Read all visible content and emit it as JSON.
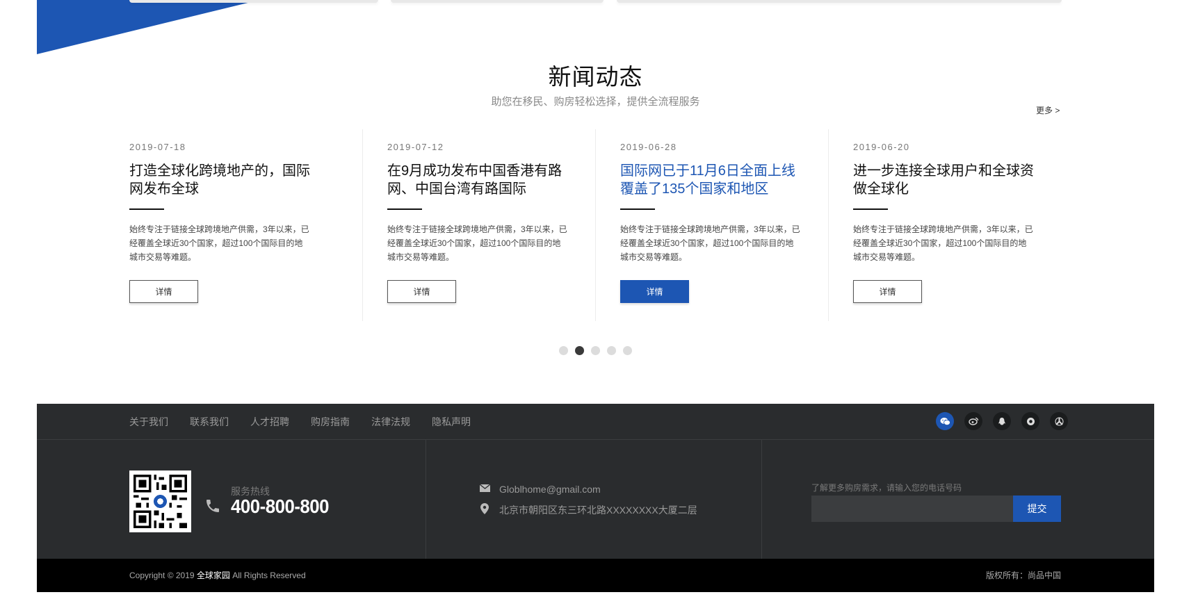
{
  "news": {
    "title": "新闻动态",
    "subtitle": "助您在移民、购房轻松选择，提供全流程服务",
    "more": "更多 >",
    "detail_label": "详情",
    "items": [
      {
        "date": "2019-07-18",
        "title": "打造全球化跨境地产的，国际网发布全球",
        "desc": "始终专注于链接全球跨境地产供需，3年以来，已经覆盖全球近30个国家，超过100个国际目的地城市交易等难题。"
      },
      {
        "date": "2019-07-12",
        "title": "在9月成功发布中国香港有路网、中国台湾有路国际",
        "desc": "始终专注于链接全球跨境地产供需，3年以来，已经覆盖全球近30个国家，超过100个国际目的地城市交易等难题。"
      },
      {
        "date": "2019-06-28",
        "title": "国际网已于11月6日全面上线覆盖了135个国家和地区",
        "desc": "始终专注于链接全球跨境地产供需，3年以来，已经覆盖全球近30个国家，超过100个国际目的地城市交易等难题。"
      },
      {
        "date": "2019-06-20",
        "title": "进一步连接全球用户和全球资做全球化",
        "desc": "始终专注于链接全球跨境地产供需，3年以来，已经覆盖全球近30个国家，超过100个国际目的地城市交易等难题。"
      }
    ],
    "active_index": 2,
    "pagination": {
      "count": 5,
      "current": 2
    }
  },
  "footer": {
    "nav": [
      "关于我们",
      "联系我们",
      "人才招聘",
      "购房指南",
      "法律法规",
      "隐私声明"
    ],
    "socials": [
      "wechat-icon",
      "weibo-icon",
      "qq-icon",
      "camera-icon",
      "pinwheel-icon"
    ],
    "hotline_label": "服务热线",
    "hotline": "400-800-800",
    "email": "Globlhome@gmail.com",
    "address": "北京市朝阳区东三环北路XXXXXXXX大厦二层",
    "subscribe_hint": "了解更多购房需求，请输入您的电话号码",
    "subscribe_value": "",
    "submit_label": "提交",
    "copyright_prefix": "Copyright © 2019 ",
    "copyright_brand": "全球家园",
    "copyright_suffix": " All Rights Reserved",
    "rights": "版权所有：尚品中国"
  },
  "colors": {
    "accent": "#1d56b3",
    "footer_bg": "#2a2c2e",
    "copyright_bg": "#000000"
  }
}
